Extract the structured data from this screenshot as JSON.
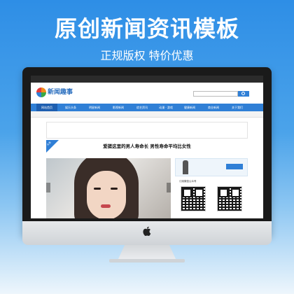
{
  "promo": {
    "headline": "原创新闻资讯模板",
    "subline": "正规版权 特价优惠"
  },
  "site": {
    "logo_text": "新闻趣事",
    "nav": [
      "网站首页",
      "娱乐头条",
      "明星新闻",
      "影视新闻",
      "综艺资讯",
      "动漫 · 游戏",
      "健康新闻",
      "商业新闻",
      "关于我们"
    ],
    "featured_title": "爱搓这里的男人寿命长 男性寿命平均比女性",
    "ribbon_label": "头条",
    "qr_title": "订阅微信公众号"
  },
  "colors": {
    "brand_blue": "#2f7fd6",
    "nav_active": "#1e5fb0"
  }
}
